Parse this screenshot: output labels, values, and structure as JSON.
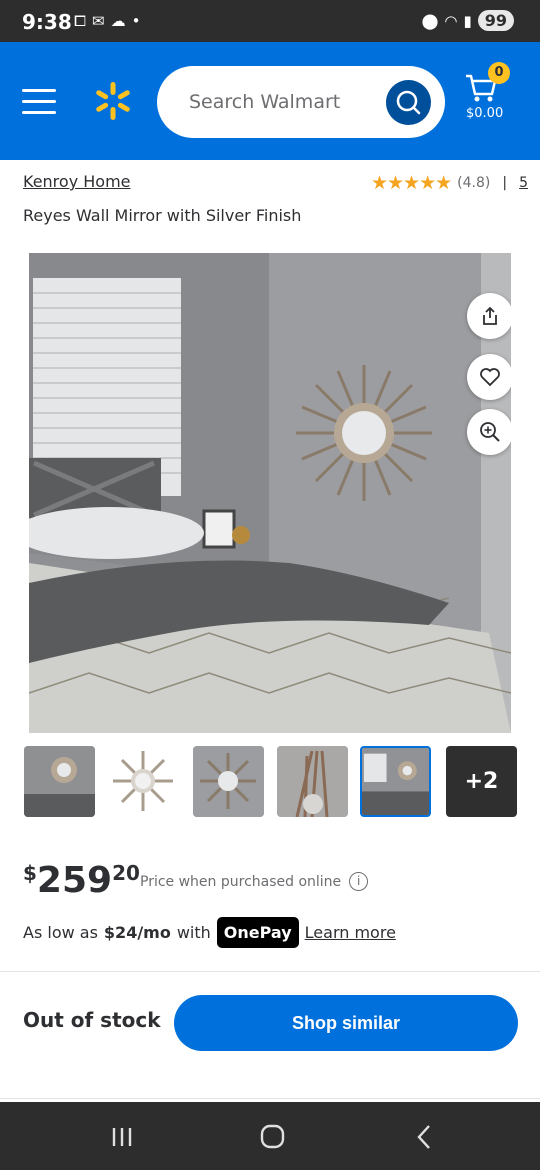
{
  "status_bar": {
    "time": "9:38",
    "battery": "99"
  },
  "header": {
    "search_placeholder": "Search Walmart",
    "cart_count": "0",
    "cart_total": "$0.00"
  },
  "product": {
    "brand": "Kenroy Home",
    "stars": "★★★★★",
    "rating": "(4.8)",
    "separator": "|",
    "review_count": "5",
    "title": "Reyes Wall Mirror with Silver Finish",
    "more_images_label": "+2"
  },
  "price": {
    "currency": "$",
    "whole": "259",
    "cents": "20",
    "note": "Price when purchased online",
    "info": "i"
  },
  "financing": {
    "prefix": "As low as",
    "amount": "$24/mo",
    "with": "with",
    "brand": "OnePay",
    "link": "Learn more"
  },
  "availability": {
    "status": "Out of stock",
    "button": "Shop similar"
  },
  "colors": {
    "primary": "#0071dc",
    "spark": "#ffc220",
    "star": "#f4a521"
  }
}
